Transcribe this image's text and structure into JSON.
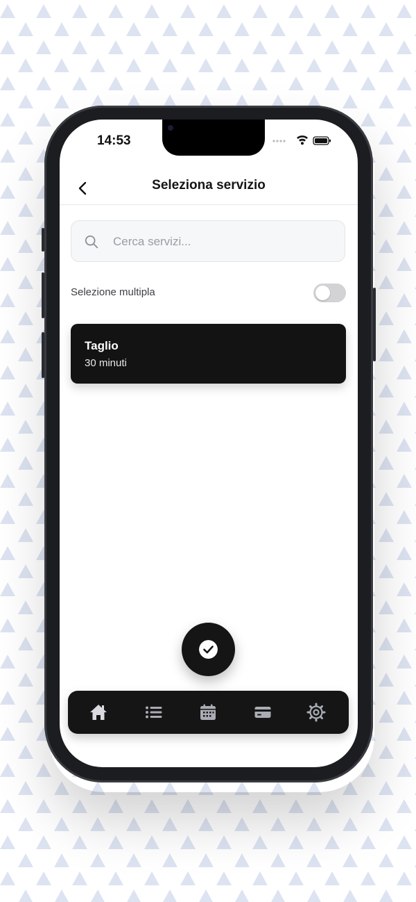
{
  "status_bar": {
    "time": "14:53"
  },
  "header": {
    "title": "Seleziona servizio",
    "back_icon": "chevron-left-icon"
  },
  "search": {
    "placeholder": "Cerca servizi...",
    "value": "",
    "icon": "search-icon"
  },
  "multi_select": {
    "label": "Selezione multipla",
    "enabled": false
  },
  "services": [
    {
      "name": "Taglio",
      "duration": "30 minuti"
    }
  ],
  "fab": {
    "icon": "check-circle-icon"
  },
  "tabbar": {
    "items": [
      {
        "icon": "home-icon",
        "active": true
      },
      {
        "icon": "list-icon",
        "active": false
      },
      {
        "icon": "calendar-icon",
        "active": false
      },
      {
        "icon": "card-icon",
        "active": false
      },
      {
        "icon": "gear-icon",
        "active": false
      }
    ]
  },
  "colors": {
    "pattern": "#dde3f1",
    "card": "#131313",
    "tabbar": "#151515",
    "active_tab": "#d9dbe0",
    "inactive_tab": "#a9acb4"
  }
}
